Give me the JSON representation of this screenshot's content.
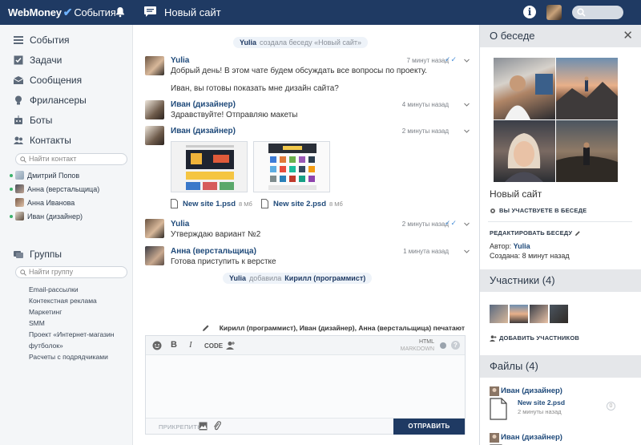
{
  "topbar": {
    "brand": "WebMoney",
    "brand_section": "События",
    "chat_title": "Новый сайт",
    "icons": [
      "bell-icon",
      "chat-icon",
      "info-icon",
      "avatar",
      "search-icon"
    ]
  },
  "sidebar": {
    "nav": [
      {
        "label": "События",
        "icon": "events-icon"
      },
      {
        "label": "Задачи",
        "icon": "tasks-icon"
      },
      {
        "label": "Сообщения",
        "icon": "messages-icon"
      },
      {
        "label": "Фрилансеры",
        "icon": "freelancers-icon"
      },
      {
        "label": "Боты",
        "icon": "bots-icon"
      },
      {
        "label": "Контакты",
        "icon": "contacts-icon"
      }
    ],
    "contact_search_placeholder": "Найти контакт",
    "contacts": [
      {
        "name": "Дмитрий Попов",
        "online": true
      },
      {
        "name": "Анна (верстальщица)",
        "online": true
      },
      {
        "name": "Анна Иванова",
        "online": false
      },
      {
        "name": "Иван (дизайнер)",
        "online": true
      }
    ],
    "groups_label": "Группы",
    "group_search_placeholder": "Найти группу",
    "groups": [
      "Email-рассылки",
      "Контекстная реклама",
      "Маркетинг",
      "SMM",
      "Проект «Интернет-магазин",
      "футболок»",
      "Расчеты с подрядчиками"
    ]
  },
  "chat": {
    "system_created": {
      "actor": "Yulia",
      "text": "создала беседу «Новый сайт»"
    },
    "messages": [
      {
        "author": "Yulia",
        "time": "7 минут назад",
        "lines": [
          "Добрый день! В этом чате будем обсуждать все вопросы по проекту.",
          "Иван, вы готовы показать мне дизайн сайта?"
        ],
        "read": true
      },
      {
        "author": "Иван (дизайнер)",
        "time": "4 минуты назад",
        "lines": [
          "Здравствуйте! Отправляю макеты"
        ],
        "read": false
      },
      {
        "author": "Иван (дизайнер)",
        "time": "2 минуты назад",
        "lines": [],
        "read": false
      },
      {
        "author": "Yulia",
        "time": "2 минуты назад",
        "lines": [
          "Утверждаю вариант №2"
        ],
        "read": true
      },
      {
        "author": "Анна (верстальщица)",
        "time": "1 минута назад",
        "lines": [
          "Готова приступить к верстке"
        ],
        "read": false
      }
    ],
    "files": [
      {
        "name": "New site 1.psd",
        "size": "8 Мб"
      },
      {
        "name": "New site 2.psd",
        "size": "8 Мб"
      }
    ],
    "system_added": {
      "actor": "Yulia",
      "text": "добавила",
      "target": "Кирилл (программист)"
    },
    "typing": "Кирилл (программист), Иван (дизайнер), Анна (верстальщица) печатают"
  },
  "composer": {
    "tools": [
      "B",
      "I",
      "CODE"
    ],
    "html_label": "HTML",
    "markdown_label": "MARKDOWN",
    "help": "?",
    "attach_label": "ПРИКРЕПИТЬ",
    "send_label": "ОТПРАВИТЬ"
  },
  "panel": {
    "title": "О беседе",
    "chat_name": "Новый сайт",
    "participating": "ВЫ УЧАСТВУЕТЕ В БЕСЕДЕ",
    "edit_label": "РЕДАКТИРОВАТЬ БЕСЕДУ",
    "author_label": "Автор:",
    "author_name": "Yulia",
    "created_label": "Создана:",
    "created_value": "8 минут назад",
    "members_title": "Участники (4)",
    "add_members": "ДОБАВИТЬ УЧАСТНИКОВ",
    "files_title": "Файлы (4)",
    "file_entries": [
      {
        "uploader": "Иван (дизайнер)",
        "file": "New site 2.psd",
        "time": "2 минуты назад",
        "count": "0"
      },
      {
        "uploader": "Иван (дизайнер)"
      }
    ]
  }
}
